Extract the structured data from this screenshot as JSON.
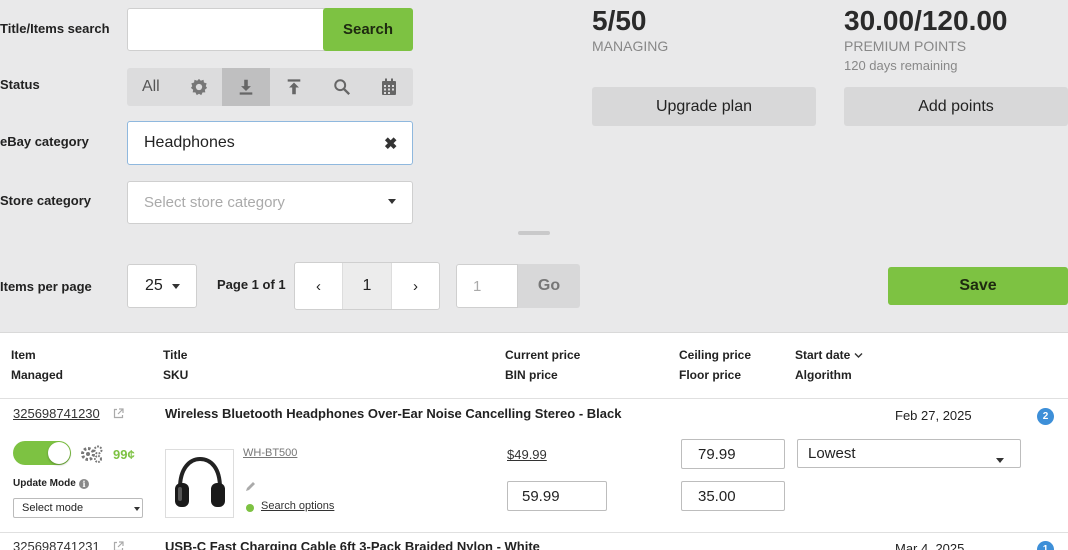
{
  "filters": {
    "title_search_label": "Title/Items search",
    "title_search_value": "",
    "search_button": "Search",
    "status_label": "Status",
    "status_all": "All",
    "ebay_category_label": "eBay category",
    "ebay_category_value": "Headphones",
    "store_category_label": "Store category",
    "store_category_placeholder": "Select store category"
  },
  "stats": {
    "managing_value": "5/50",
    "managing_label": "MANAGING",
    "premium_value": "30.00/120.00",
    "premium_label": "PREMIUM POINTS",
    "days_remaining": "120 days remaining",
    "upgrade_button": "Upgrade plan",
    "add_points_button": "Add points"
  },
  "pagination": {
    "items_per_page_label": "Items per page",
    "items_per_page_value": "25",
    "page_info": "Page 1 of 1",
    "prev": "‹",
    "current_page": "1",
    "next": "›",
    "goto_placeholder": "1",
    "go_button": "Go",
    "save_button": "Save"
  },
  "table": {
    "headers": {
      "item": "Item",
      "managed": "Managed",
      "title": "Title",
      "sku": "SKU",
      "current_price": "Current price",
      "bin_price": "BIN price",
      "ceiling_price": "Ceiling price",
      "floor_price": "Floor price",
      "start_date": "Start date",
      "algorithm": "Algorithm"
    },
    "rows": [
      {
        "item_id": "325698741230",
        "title": "Wireless Bluetooth Headphones Over-Ear Noise Cancelling Stereo - Black",
        "start_date": "Feb 27, 2025",
        "badge": "2",
        "managed": true,
        "fee": "99¢",
        "update_mode_label": "Update Mode",
        "update_mode_value": "Select mode",
        "sku": "WH-BT500",
        "search_options": "Search options",
        "current_price": "$49.99",
        "bin_price": "59.99",
        "ceiling_price": "79.99",
        "floor_price": "35.00",
        "algorithm": "Lowest"
      },
      {
        "item_id": "325698741231",
        "title": "USB-C Fast Charging Cable 6ft 3-Pack Braided Nylon - White",
        "start_date": "Mar 4, 2025",
        "badge": "1"
      }
    ]
  },
  "colors": {
    "accent_green": "#7dc242",
    "badge_blue": "#3d8fd8",
    "background": "#e9e9ea"
  }
}
